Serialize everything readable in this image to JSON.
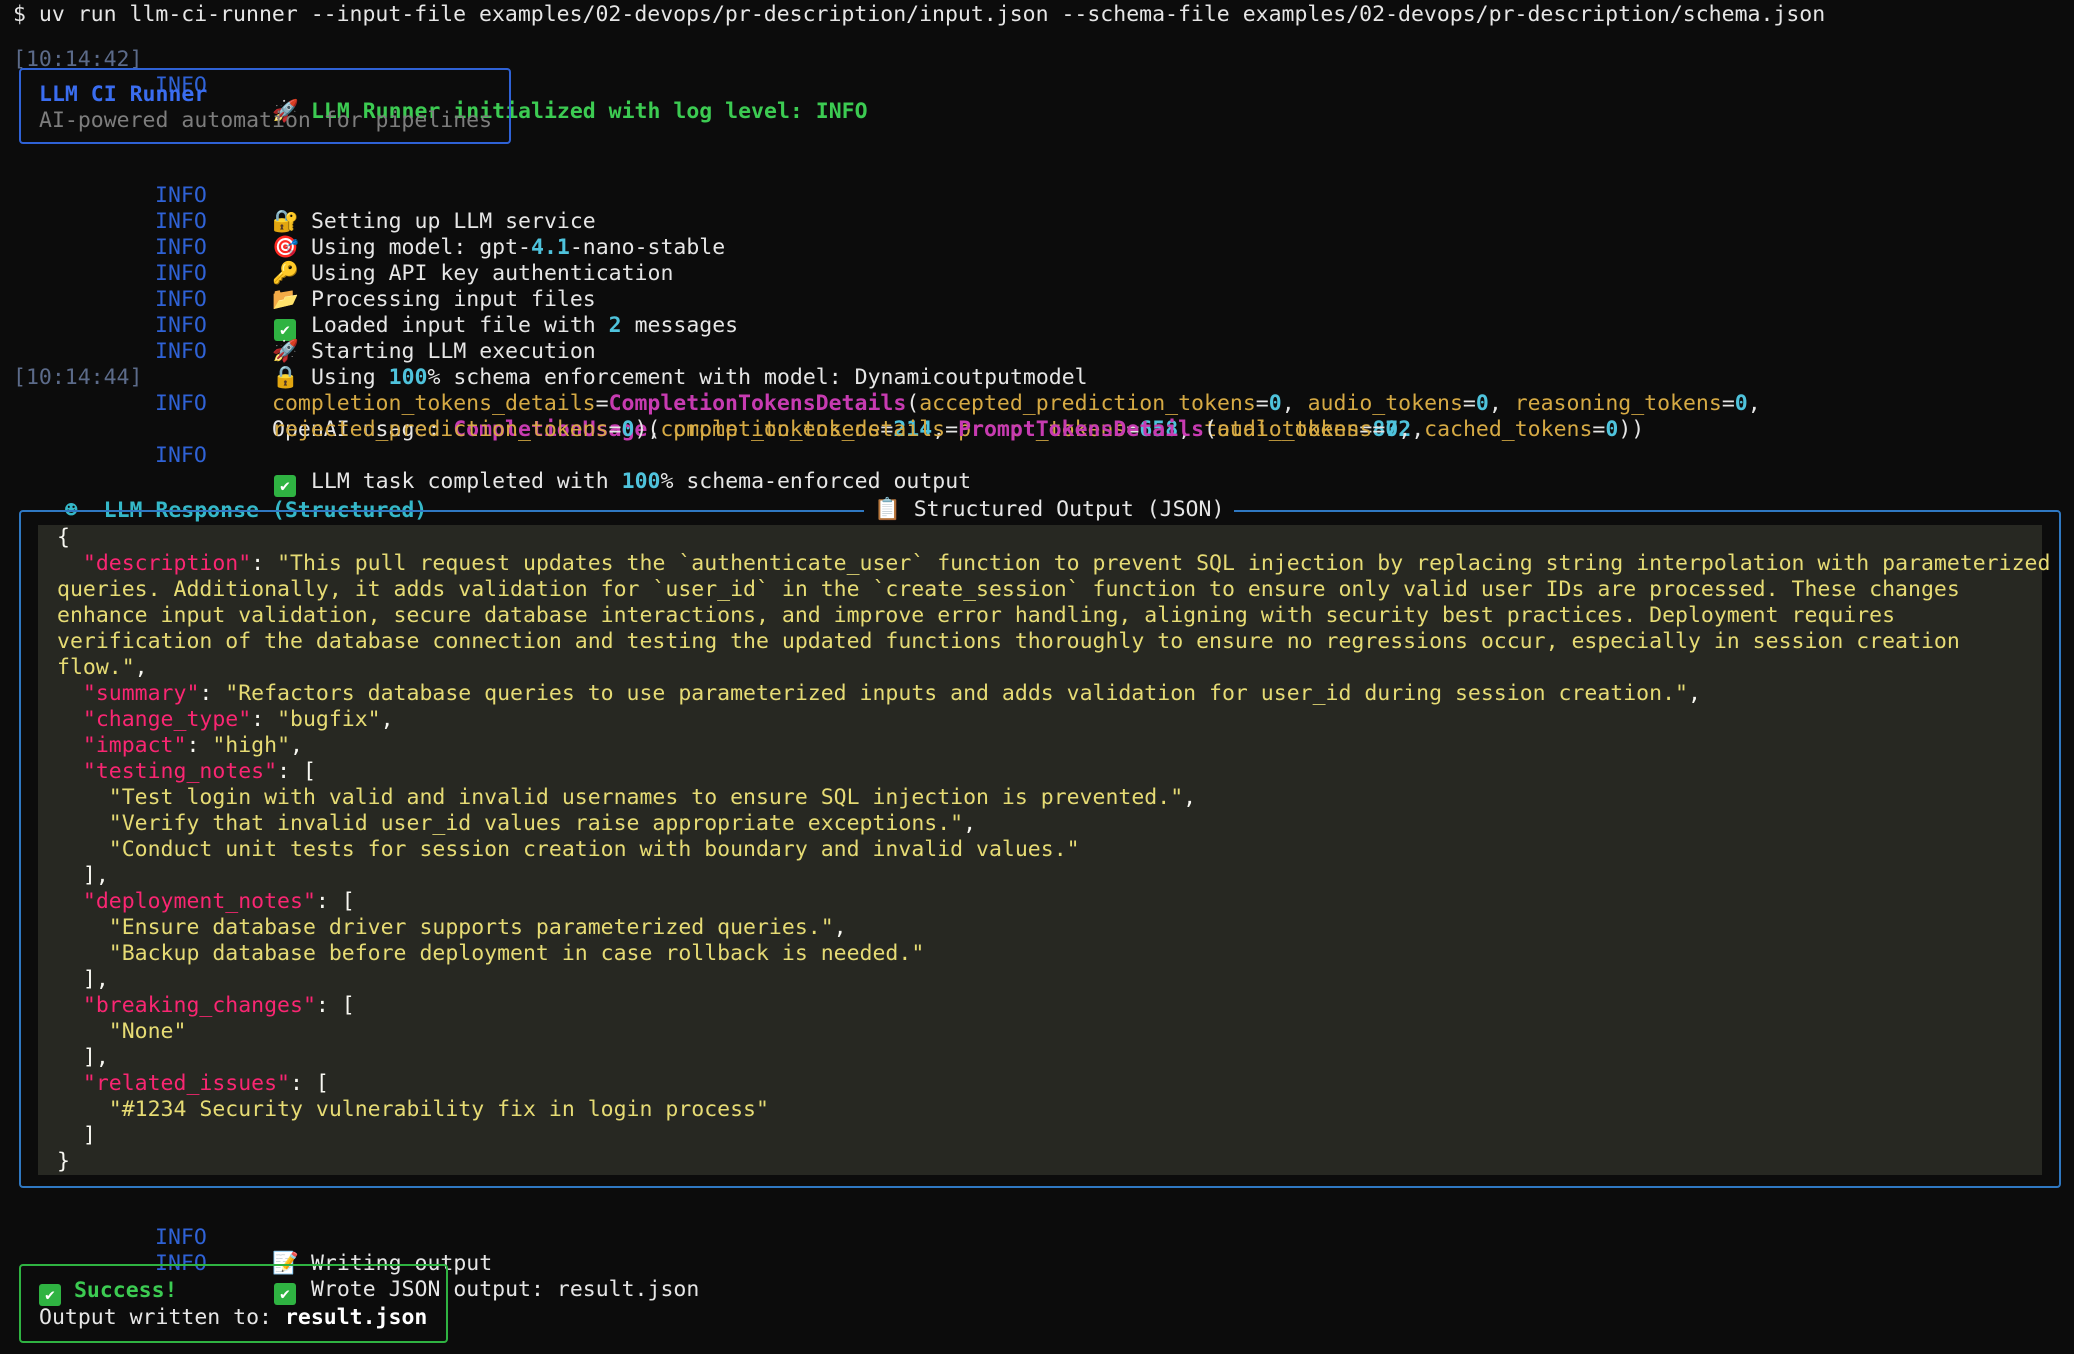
{
  "command": "$ uv run llm-ci-runner --input-file examples/02-devops/pr-description/input.json --schema-file examples/02-devops/pr-description/schema.json",
  "init_line": {
    "timestamp": "[10:14:42]",
    "level": "INFO",
    "icon": "🚀",
    "text": "LLM Runner initialized with log level: INFO"
  },
  "banner": {
    "title": "LLM CI Runner",
    "subtitle": "AI-powered automation for pipelines"
  },
  "logs": [
    {
      "level": "INFO",
      "icon": "🔐",
      "text": "Setting up LLM service"
    },
    {
      "level": "INFO",
      "icon": "🎯",
      "pre": "Using model: gpt-",
      "num": "4.1",
      "post": "-nano-stable"
    },
    {
      "level": "INFO",
      "icon": "🔑",
      "text": "Using API key authentication"
    },
    {
      "level": "INFO",
      "icon": "📂",
      "text": "Processing input files"
    },
    {
      "level": "INFO",
      "icon": "✔",
      "pre": "Loaded input file with ",
      "num": "2",
      "post": " messages"
    },
    {
      "level": "INFO",
      "icon": "🚀",
      "text": "Starting LLM execution"
    },
    {
      "level": "INFO",
      "icon": "🔒",
      "pre": "Using ",
      "num": "100",
      "post": "% schema enforcement with model: Dynamicoutputmodel"
    }
  ],
  "usage": {
    "timestamp": "[10:14:44]",
    "level": "INFO",
    "prefix": "OpenAI usage: ",
    "class1": "CompletionUsage",
    "k_completion": "completion_tokens",
    "v_completion": "214",
    "k_prompt": "prompt_tokens",
    "v_prompt": "658",
    "k_total": "total_tokens",
    "v_total": "872",
    "k_ctd": "completion_tokens_details",
    "class2": "CompletionTokensDetails",
    "k_accepted": "accepted_prediction_tokens",
    "v_accepted": "0",
    "k_audio": "audio_tokens",
    "v_audio": "0",
    "k_reasoning": "reasoning_tokens",
    "v_reasoning": "0",
    "k_rejected": "rejected_prediction_tokens",
    "v_rejected": "0",
    "k_ptd": "prompt_tokens_details",
    "class3": "PromptTokensDetails",
    "k_audio2": "audio_tokens",
    "v_audio2": "0",
    "k_cached": "cached_tokens",
    "v_cached": "0"
  },
  "completed": {
    "level": "INFO",
    "icon": "✔",
    "pre": "LLM task completed with ",
    "num": "100",
    "post": "% schema-enforced output"
  },
  "response_header": {
    "icon": "☻",
    "text": "LLM Response (Structured)"
  },
  "panel_title": {
    "icon": "📋",
    "text": "Structured Output (JSON)"
  },
  "json_lines": [
    [
      {
        "t": "p",
        "v": "{"
      }
    ],
    [
      {
        "t": "p",
        "v": "  "
      },
      {
        "t": "k",
        "v": "\"description\""
      },
      {
        "t": "p",
        "v": ": "
      },
      {
        "t": "s",
        "v": "\"This pull request updates the `authenticate_user` function to prevent SQL injection by replacing string interpolation with parameterized"
      }
    ],
    [
      {
        "t": "s",
        "v": "queries. Additionally, it adds validation for `user_id` in the `create_session` function to ensure only valid user IDs are processed. These changes"
      }
    ],
    [
      {
        "t": "s",
        "v": "enhance input validation, secure database interactions, and improve error handling, aligning with security best practices. Deployment requires"
      }
    ],
    [
      {
        "t": "s",
        "v": "verification of the database connection and testing the updated functions thoroughly to ensure no regressions occur, especially in session creation"
      }
    ],
    [
      {
        "t": "s",
        "v": "flow.\""
      },
      {
        "t": "p",
        "v": ","
      }
    ],
    [
      {
        "t": "p",
        "v": "  "
      },
      {
        "t": "k",
        "v": "\"summary\""
      },
      {
        "t": "p",
        "v": ": "
      },
      {
        "t": "s",
        "v": "\"Refactors database queries to use parameterized inputs and adds validation for user_id during session creation.\""
      },
      {
        "t": "p",
        "v": ","
      }
    ],
    [
      {
        "t": "p",
        "v": "  "
      },
      {
        "t": "k",
        "v": "\"change_type\""
      },
      {
        "t": "p",
        "v": ": "
      },
      {
        "t": "s",
        "v": "\"bugfix\""
      },
      {
        "t": "p",
        "v": ","
      }
    ],
    [
      {
        "t": "p",
        "v": "  "
      },
      {
        "t": "k",
        "v": "\"impact\""
      },
      {
        "t": "p",
        "v": ": "
      },
      {
        "t": "s",
        "v": "\"high\""
      },
      {
        "t": "p",
        "v": ","
      }
    ],
    [
      {
        "t": "p",
        "v": "  "
      },
      {
        "t": "k",
        "v": "\"testing_notes\""
      },
      {
        "t": "p",
        "v": ": ["
      }
    ],
    [
      {
        "t": "p",
        "v": "    "
      },
      {
        "t": "s",
        "v": "\"Test login with valid and invalid usernames to ensure SQL injection is prevented.\""
      },
      {
        "t": "p",
        "v": ","
      }
    ],
    [
      {
        "t": "p",
        "v": "    "
      },
      {
        "t": "s",
        "v": "\"Verify that invalid user_id values raise appropriate exceptions.\""
      },
      {
        "t": "p",
        "v": ","
      }
    ],
    [
      {
        "t": "p",
        "v": "    "
      },
      {
        "t": "s",
        "v": "\"Conduct unit tests for session creation with boundary and invalid values.\""
      }
    ],
    [
      {
        "t": "p",
        "v": "  ],"
      }
    ],
    [
      {
        "t": "p",
        "v": "  "
      },
      {
        "t": "k",
        "v": "\"deployment_notes\""
      },
      {
        "t": "p",
        "v": ": ["
      }
    ],
    [
      {
        "t": "p",
        "v": "    "
      },
      {
        "t": "s",
        "v": "\"Ensure database driver supports parameterized queries.\""
      },
      {
        "t": "p",
        "v": ","
      }
    ],
    [
      {
        "t": "p",
        "v": "    "
      },
      {
        "t": "s",
        "v": "\"Backup database before deployment in case rollback is needed.\""
      }
    ],
    [
      {
        "t": "p",
        "v": "  ],"
      }
    ],
    [
      {
        "t": "p",
        "v": "  "
      },
      {
        "t": "k",
        "v": "\"breaking_changes\""
      },
      {
        "t": "p",
        "v": ": ["
      }
    ],
    [
      {
        "t": "p",
        "v": "    "
      },
      {
        "t": "s",
        "v": "\"None\""
      }
    ],
    [
      {
        "t": "p",
        "v": "  ],"
      }
    ],
    [
      {
        "t": "p",
        "v": "  "
      },
      {
        "t": "k",
        "v": "\"related_issues\""
      },
      {
        "t": "p",
        "v": ": ["
      }
    ],
    [
      {
        "t": "p",
        "v": "    "
      },
      {
        "t": "s",
        "v": "\"#1234 Security vulnerability fix in login process\""
      }
    ],
    [
      {
        "t": "p",
        "v": "  ]"
      }
    ],
    [
      {
        "t": "p",
        "v": "}"
      }
    ]
  ],
  "post_logs": [
    {
      "level": "INFO",
      "icon": "📝",
      "text": "Writing output"
    },
    {
      "level": "INFO",
      "icon": "✔",
      "text": "Wrote JSON output: result.json"
    }
  ],
  "success": {
    "icon": "✔",
    "title": "Success!",
    "label": "Output written to: ",
    "file": "result.json"
  },
  "colors": {
    "background": "#0c0c0c",
    "info": "#2f62d6",
    "number": "#4fc3dc",
    "class_name": "#c73bb1",
    "key": "#d6aa44",
    "success": "#3ccb52",
    "json_bg": "#272822",
    "json_key": "#f92672",
    "json_string": "#e6db74"
  }
}
